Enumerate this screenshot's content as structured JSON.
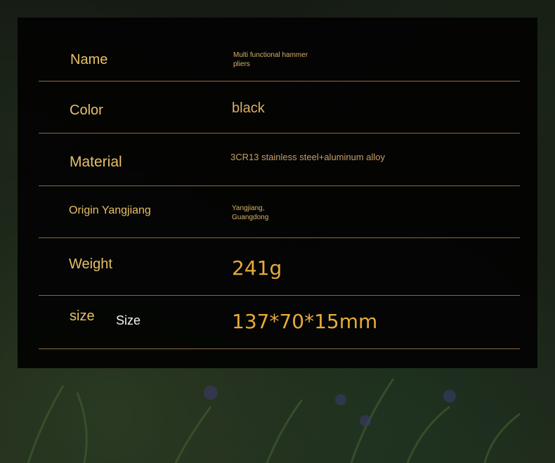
{
  "rows": [
    {
      "label": "Name",
      "value_line1": "Multi functional hammer",
      "value_line2": "pliers"
    },
    {
      "label": "Color",
      "value": "black"
    },
    {
      "label": "Material",
      "value": "3CR13 stainless steel+aluminum alloy"
    },
    {
      "label": "Origin Yangjiang",
      "value_line1": "Yangjiang,",
      "value_line2": "Guangdong"
    },
    {
      "label": "Weight",
      "value": "241g"
    },
    {
      "label": "size",
      "label_extra": "Size",
      "value": "137*70*15mm"
    }
  ]
}
